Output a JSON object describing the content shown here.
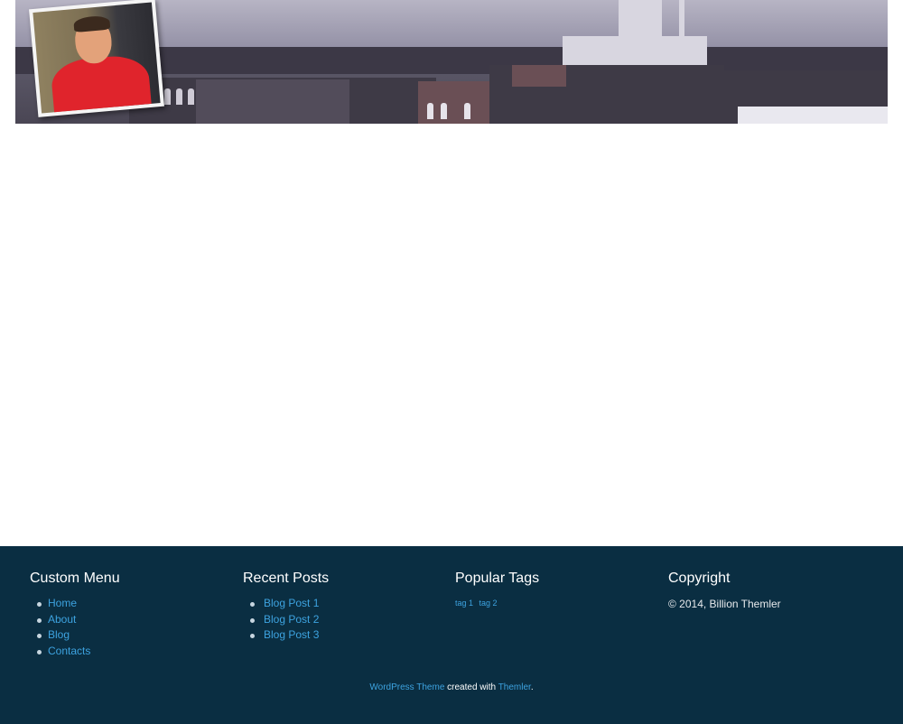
{
  "footer": {
    "custom_menu": {
      "heading": "Custom Menu",
      "items": [
        {
          "label": "Home"
        },
        {
          "label": "About"
        },
        {
          "label": "Blog"
        },
        {
          "label": "Contacts"
        }
      ]
    },
    "recent_posts": {
      "heading": "Recent Posts",
      "items": [
        {
          "label": "Blog Post 1"
        },
        {
          "label": "Blog Post 2"
        },
        {
          "label": "Blog Post 3"
        }
      ]
    },
    "popular_tags": {
      "heading": "Popular Tags",
      "tags": [
        {
          "label": "tag 1"
        },
        {
          "label": "tag 2"
        }
      ]
    },
    "copyright": {
      "heading": "Copyright",
      "text": "© 2014, Billion Themler"
    },
    "credit": {
      "link1": "WordPress Theme",
      "middle": " created with ",
      "link2": "Themler",
      "end": "."
    }
  },
  "colors": {
    "footer_bg": "#0a2e42",
    "link": "#3da3e0",
    "heading": "#ffffff"
  }
}
